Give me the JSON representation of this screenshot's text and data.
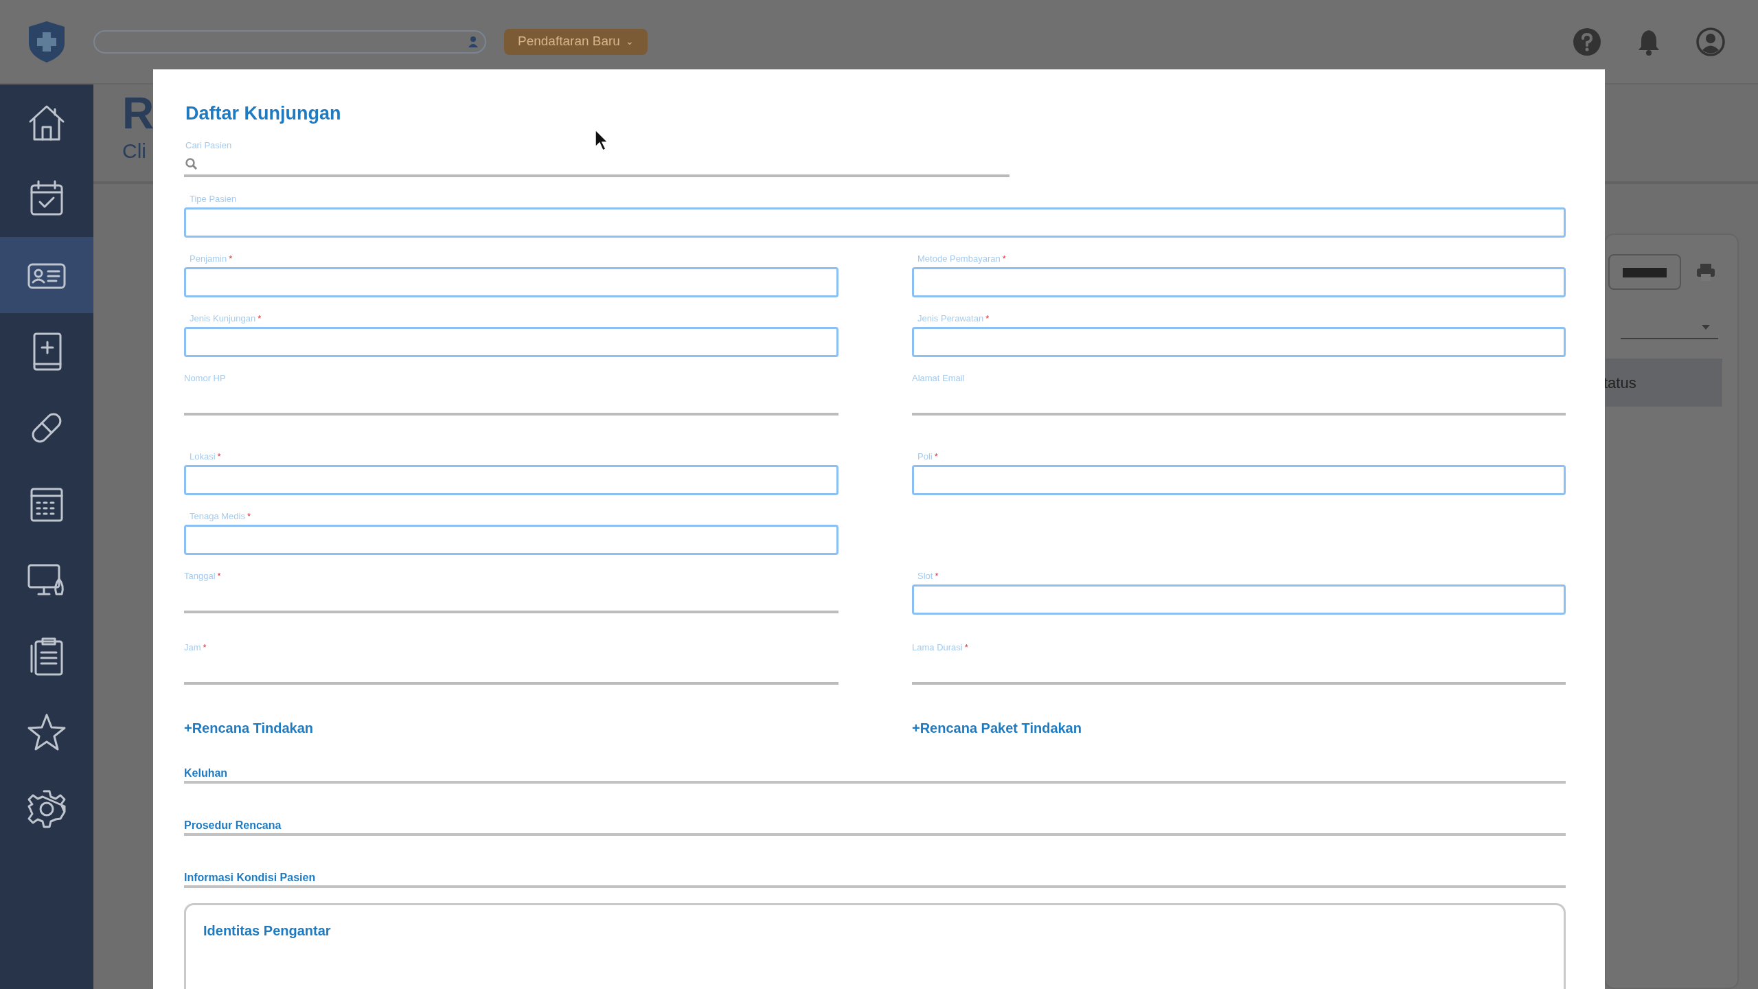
{
  "header": {
    "new_button": "Pendaftaran Baru",
    "new_caret": "⌄"
  },
  "sidebar": {
    "items": [
      {
        "kind": "home",
        "selected": false
      },
      {
        "kind": "calendar-check",
        "selected": false
      },
      {
        "kind": "id-card",
        "selected": true
      },
      {
        "kind": "medical-book",
        "selected": false
      },
      {
        "kind": "pill",
        "selected": false
      },
      {
        "kind": "calendar-grid",
        "selected": false
      },
      {
        "kind": "monitor",
        "selected": false
      },
      {
        "kind": "clipboard",
        "selected": false
      },
      {
        "kind": "star",
        "selected": false
      },
      {
        "kind": "gear",
        "selected": false
      }
    ]
  },
  "background": {
    "title": "R",
    "subtitle": "Cli",
    "column": "tatus"
  },
  "modal": {
    "title": "Daftar Kunjungan",
    "search": {
      "label": "Cari Pasien"
    },
    "rows": [
      {
        "left": {
          "label": "Tipe Pasien",
          "kind": "box",
          "full": true
        }
      },
      {
        "left": {
          "label": "Penjamin",
          "mark": "*",
          "kind": "box"
        },
        "right": {
          "label": "Metode Pembayaran",
          "mark": "*",
          "kind": "box"
        }
      },
      {
        "left": {
          "label": "Jenis Kunjungan",
          "mark": "*",
          "kind": "box"
        },
        "right": {
          "label": "Jenis Perawatan",
          "mark": "*",
          "kind": "box"
        }
      },
      {
        "left": {
          "label": "Nomor HP",
          "kind": "line"
        },
        "right": {
          "label": "Alamat Email",
          "kind": "line"
        }
      },
      {
        "left": {
          "label": "Lokasi",
          "mark": "*",
          "kind": "box"
        },
        "right": {
          "label": "Poli",
          "mark": "*",
          "kind": "box"
        }
      },
      {
        "left": {
          "label": "Tenaga Medis",
          "mark": "*",
          "kind": "box"
        }
      },
      {
        "left": {
          "label": "Tanggal",
          "mark": "*",
          "kind": "line"
        },
        "right": {
          "label": "Slot",
          "mark": "*",
          "kind": "box"
        }
      },
      {
        "left": {
          "label": "Jam",
          "mark": "*",
          "kind": "line"
        },
        "right": {
          "label": "Lama Durasi",
          "mark": "*",
          "kind": "line"
        }
      }
    ],
    "links": [
      "+Rencana Tindakan",
      "+Rencana Paket Tindakan"
    ],
    "sections": [
      "Keluhan",
      "Prosedur Rencana",
      "Informasi Kondisi Pasien"
    ],
    "card": {
      "title": "Identitas Pengantar"
    }
  }
}
